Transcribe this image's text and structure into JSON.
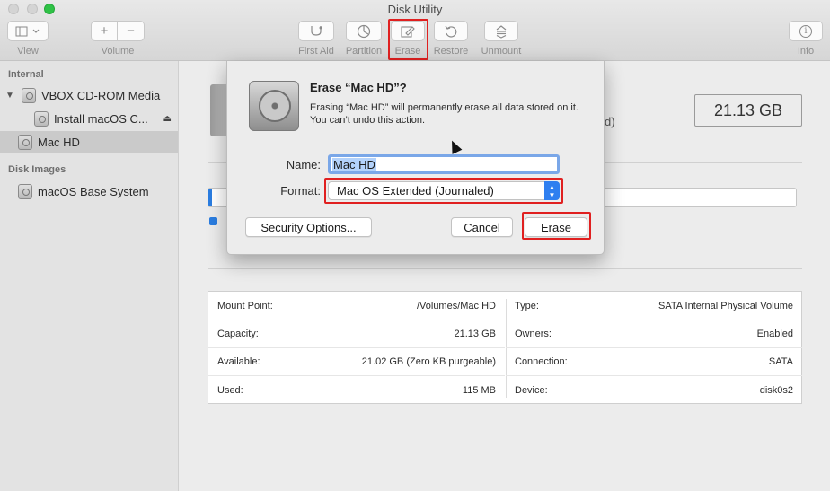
{
  "window": {
    "title": "Disk Utility"
  },
  "toolbar": {
    "view_label": "View",
    "volume_label": "Volume",
    "volume_add": "+",
    "volume_remove": "−",
    "first_aid_label": "First Aid",
    "partition_label": "Partition",
    "erase_label": "Erase",
    "restore_label": "Restore",
    "unmount_label": "Unmount",
    "info_label": "Info",
    "info_glyph": "i"
  },
  "sidebar": {
    "internal_header": "Internal",
    "disk_images_header": "Disk Images",
    "items": [
      {
        "label": "VBOX CD-ROM Media"
      },
      {
        "label": "Install macOS C..."
      },
      {
        "label": "Mac HD"
      },
      {
        "label": "macOS Base System"
      }
    ]
  },
  "main": {
    "size": "21.13 GB",
    "partial_text": "d)",
    "info_left": [
      {
        "label": "Mount Point:",
        "value": "/Volumes/Mac HD"
      },
      {
        "label": "Capacity:",
        "value": "21.13 GB"
      },
      {
        "label": "Available:",
        "value": "21.02 GB (Zero KB purgeable)"
      },
      {
        "label": "Used:",
        "value": "115 MB"
      }
    ],
    "info_right": [
      {
        "label": "Type:",
        "value": "SATA Internal Physical Volume"
      },
      {
        "label": "Owners:",
        "value": "Enabled"
      },
      {
        "label": "Connection:",
        "value": "SATA"
      },
      {
        "label": "Device:",
        "value": "disk0s2"
      }
    ]
  },
  "dialog": {
    "title": "Erase “Mac HD”?",
    "message": "Erasing “Mac HD” will permanently erase all data stored on it. You can’t undo this action.",
    "name_label": "Name:",
    "name_value": "Mac HD",
    "format_label": "Format:",
    "format_value": "Mac OS Extended (Journaled)",
    "security_button": "Security Options...",
    "cancel_button": "Cancel",
    "erase_button": "Erase"
  },
  "colors": {
    "accent": "#2f7ff0",
    "highlight": "#e02020"
  }
}
